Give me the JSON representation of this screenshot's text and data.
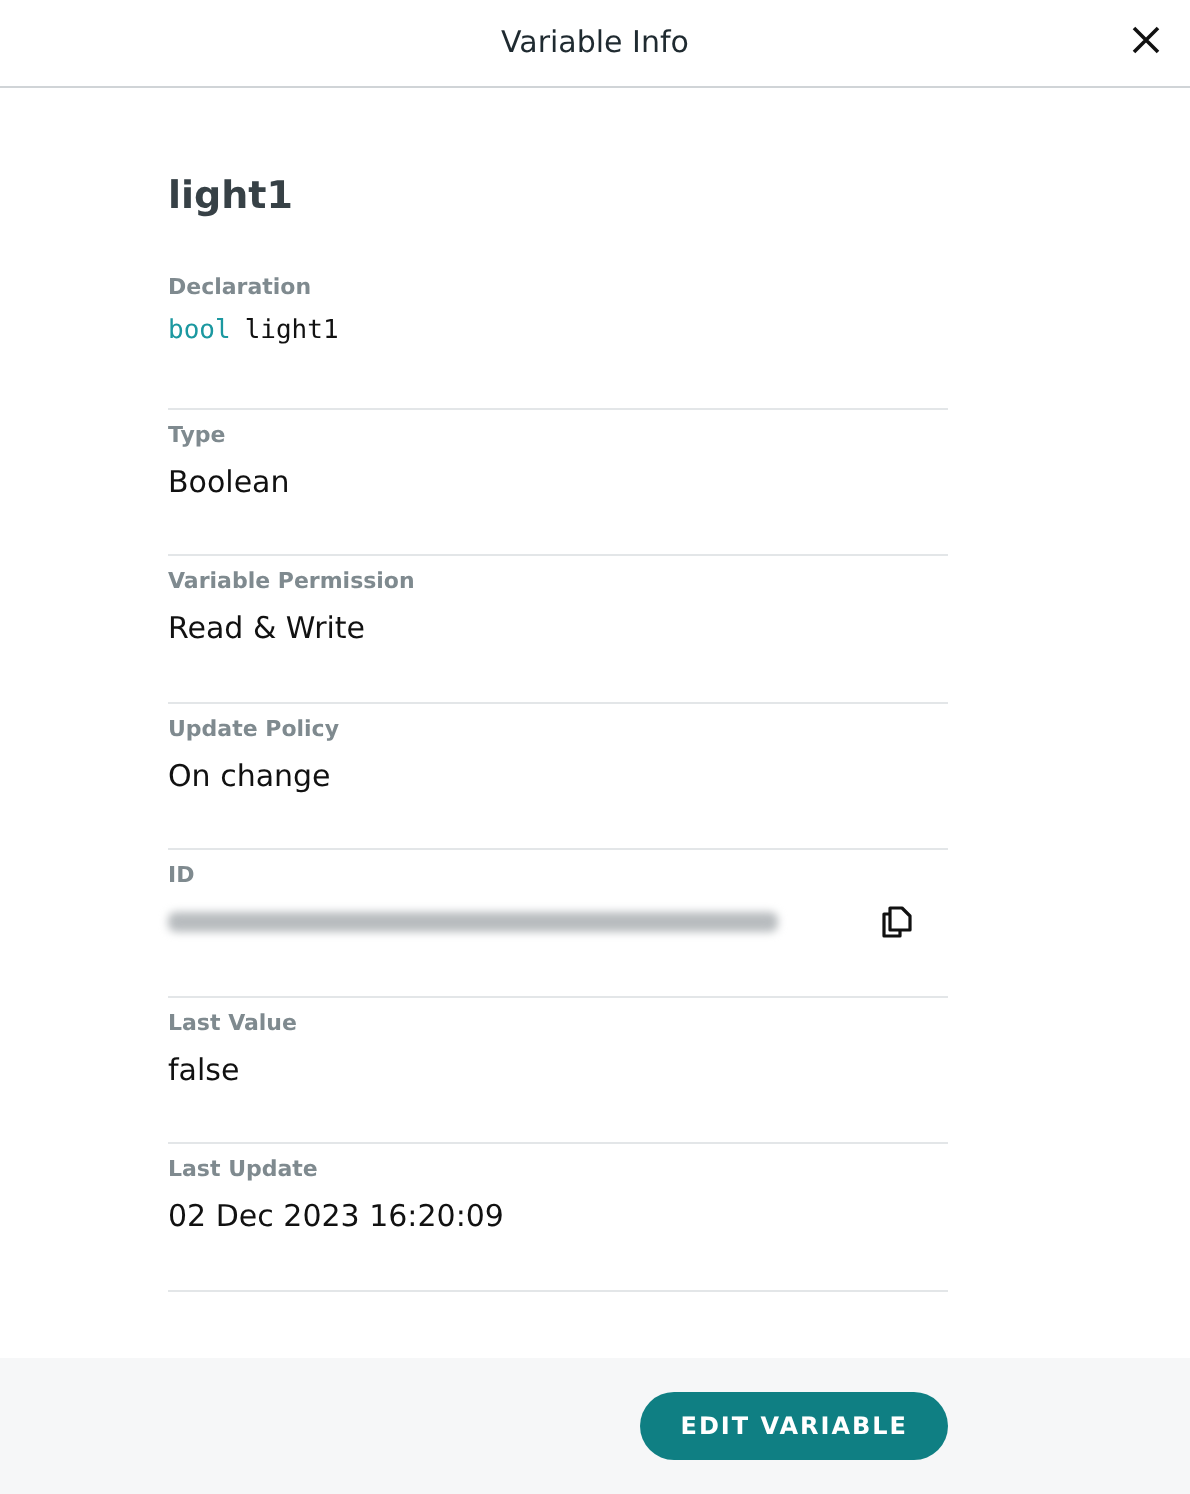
{
  "window": {
    "title": "Variable Info"
  },
  "variable": {
    "name": "light1"
  },
  "fields": [
    {
      "kind": "code",
      "label": "Declaration",
      "keyword": "bool",
      "value": "light1"
    },
    {
      "kind": "text",
      "label": "Type",
      "value": "Boolean"
    },
    {
      "kind": "text",
      "label": "Variable Permission",
      "value": "Read & Write"
    },
    {
      "kind": "text",
      "label": "Update Policy",
      "value": "On change"
    },
    {
      "kind": "redacted",
      "label": "ID"
    },
    {
      "kind": "text",
      "label": "Last Value",
      "value": "false"
    },
    {
      "kind": "text",
      "label": "Last Update",
      "value": "02 Dec 2023 16:20:09"
    }
  ],
  "footer": {
    "button": "EDIT VARIABLE"
  }
}
